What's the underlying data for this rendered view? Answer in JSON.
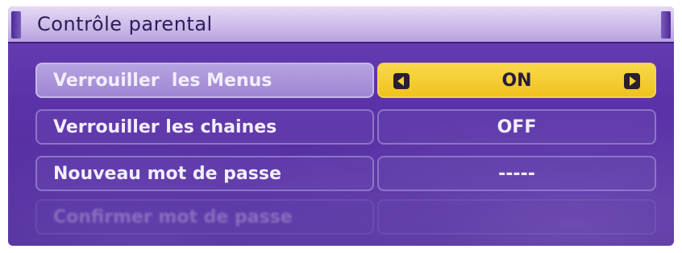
{
  "window": {
    "title": "Contrôle parental"
  },
  "menu": {
    "items": [
      {
        "label": "Verrouiller  les Menus",
        "value": "ON",
        "selected": true
      },
      {
        "label": "Verrouiller les chaines",
        "value": "OFF",
        "selected": false
      },
      {
        "label": "Nouveau mot de passe",
        "value": "-----",
        "selected": false
      },
      {
        "label": "Confirmer mot de passe",
        "value": "",
        "selected": false
      }
    ]
  },
  "colors": {
    "panel": "#5b32a8",
    "title_bar": "#cdbce9",
    "highlight_value": "#f0c21f",
    "highlight_label": "#a48dd6",
    "text": "#f3eefc"
  },
  "icons": {
    "prev": "chevron-left-icon",
    "next": "chevron-right-icon"
  }
}
